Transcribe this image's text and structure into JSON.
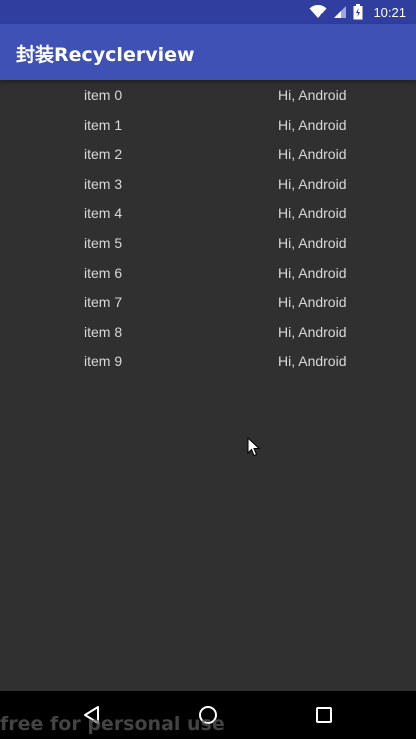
{
  "status_bar": {
    "time": "10:21",
    "icons": [
      "wifi-icon",
      "signal-icon",
      "battery-icon"
    ]
  },
  "app_bar": {
    "title": "封装Recyclerview"
  },
  "list": {
    "items": [
      {
        "left": "item 0",
        "right": "Hi, Android"
      },
      {
        "left": "item 1",
        "right": "Hi, Android"
      },
      {
        "left": "item 2",
        "right": "Hi, Android"
      },
      {
        "left": "item 3",
        "right": "Hi, Android"
      },
      {
        "left": "item 4",
        "right": "Hi, Android"
      },
      {
        "left": "item 5",
        "right": "Hi, Android"
      },
      {
        "left": "item 6",
        "right": "Hi, Android"
      },
      {
        "left": "item 7",
        "right": "Hi, Android"
      },
      {
        "left": "item 8",
        "right": "Hi, Android"
      },
      {
        "left": "item 9",
        "right": "Hi, Android"
      }
    ]
  },
  "nav_bar": {
    "icons": [
      "back-icon",
      "home-icon",
      "recent-apps-icon"
    ]
  },
  "watermark": "free for personal use",
  "colors": {
    "status_bar": "#303F9F",
    "app_bar": "#3F51B5",
    "background": "#303030",
    "nav_bar": "#000000"
  }
}
